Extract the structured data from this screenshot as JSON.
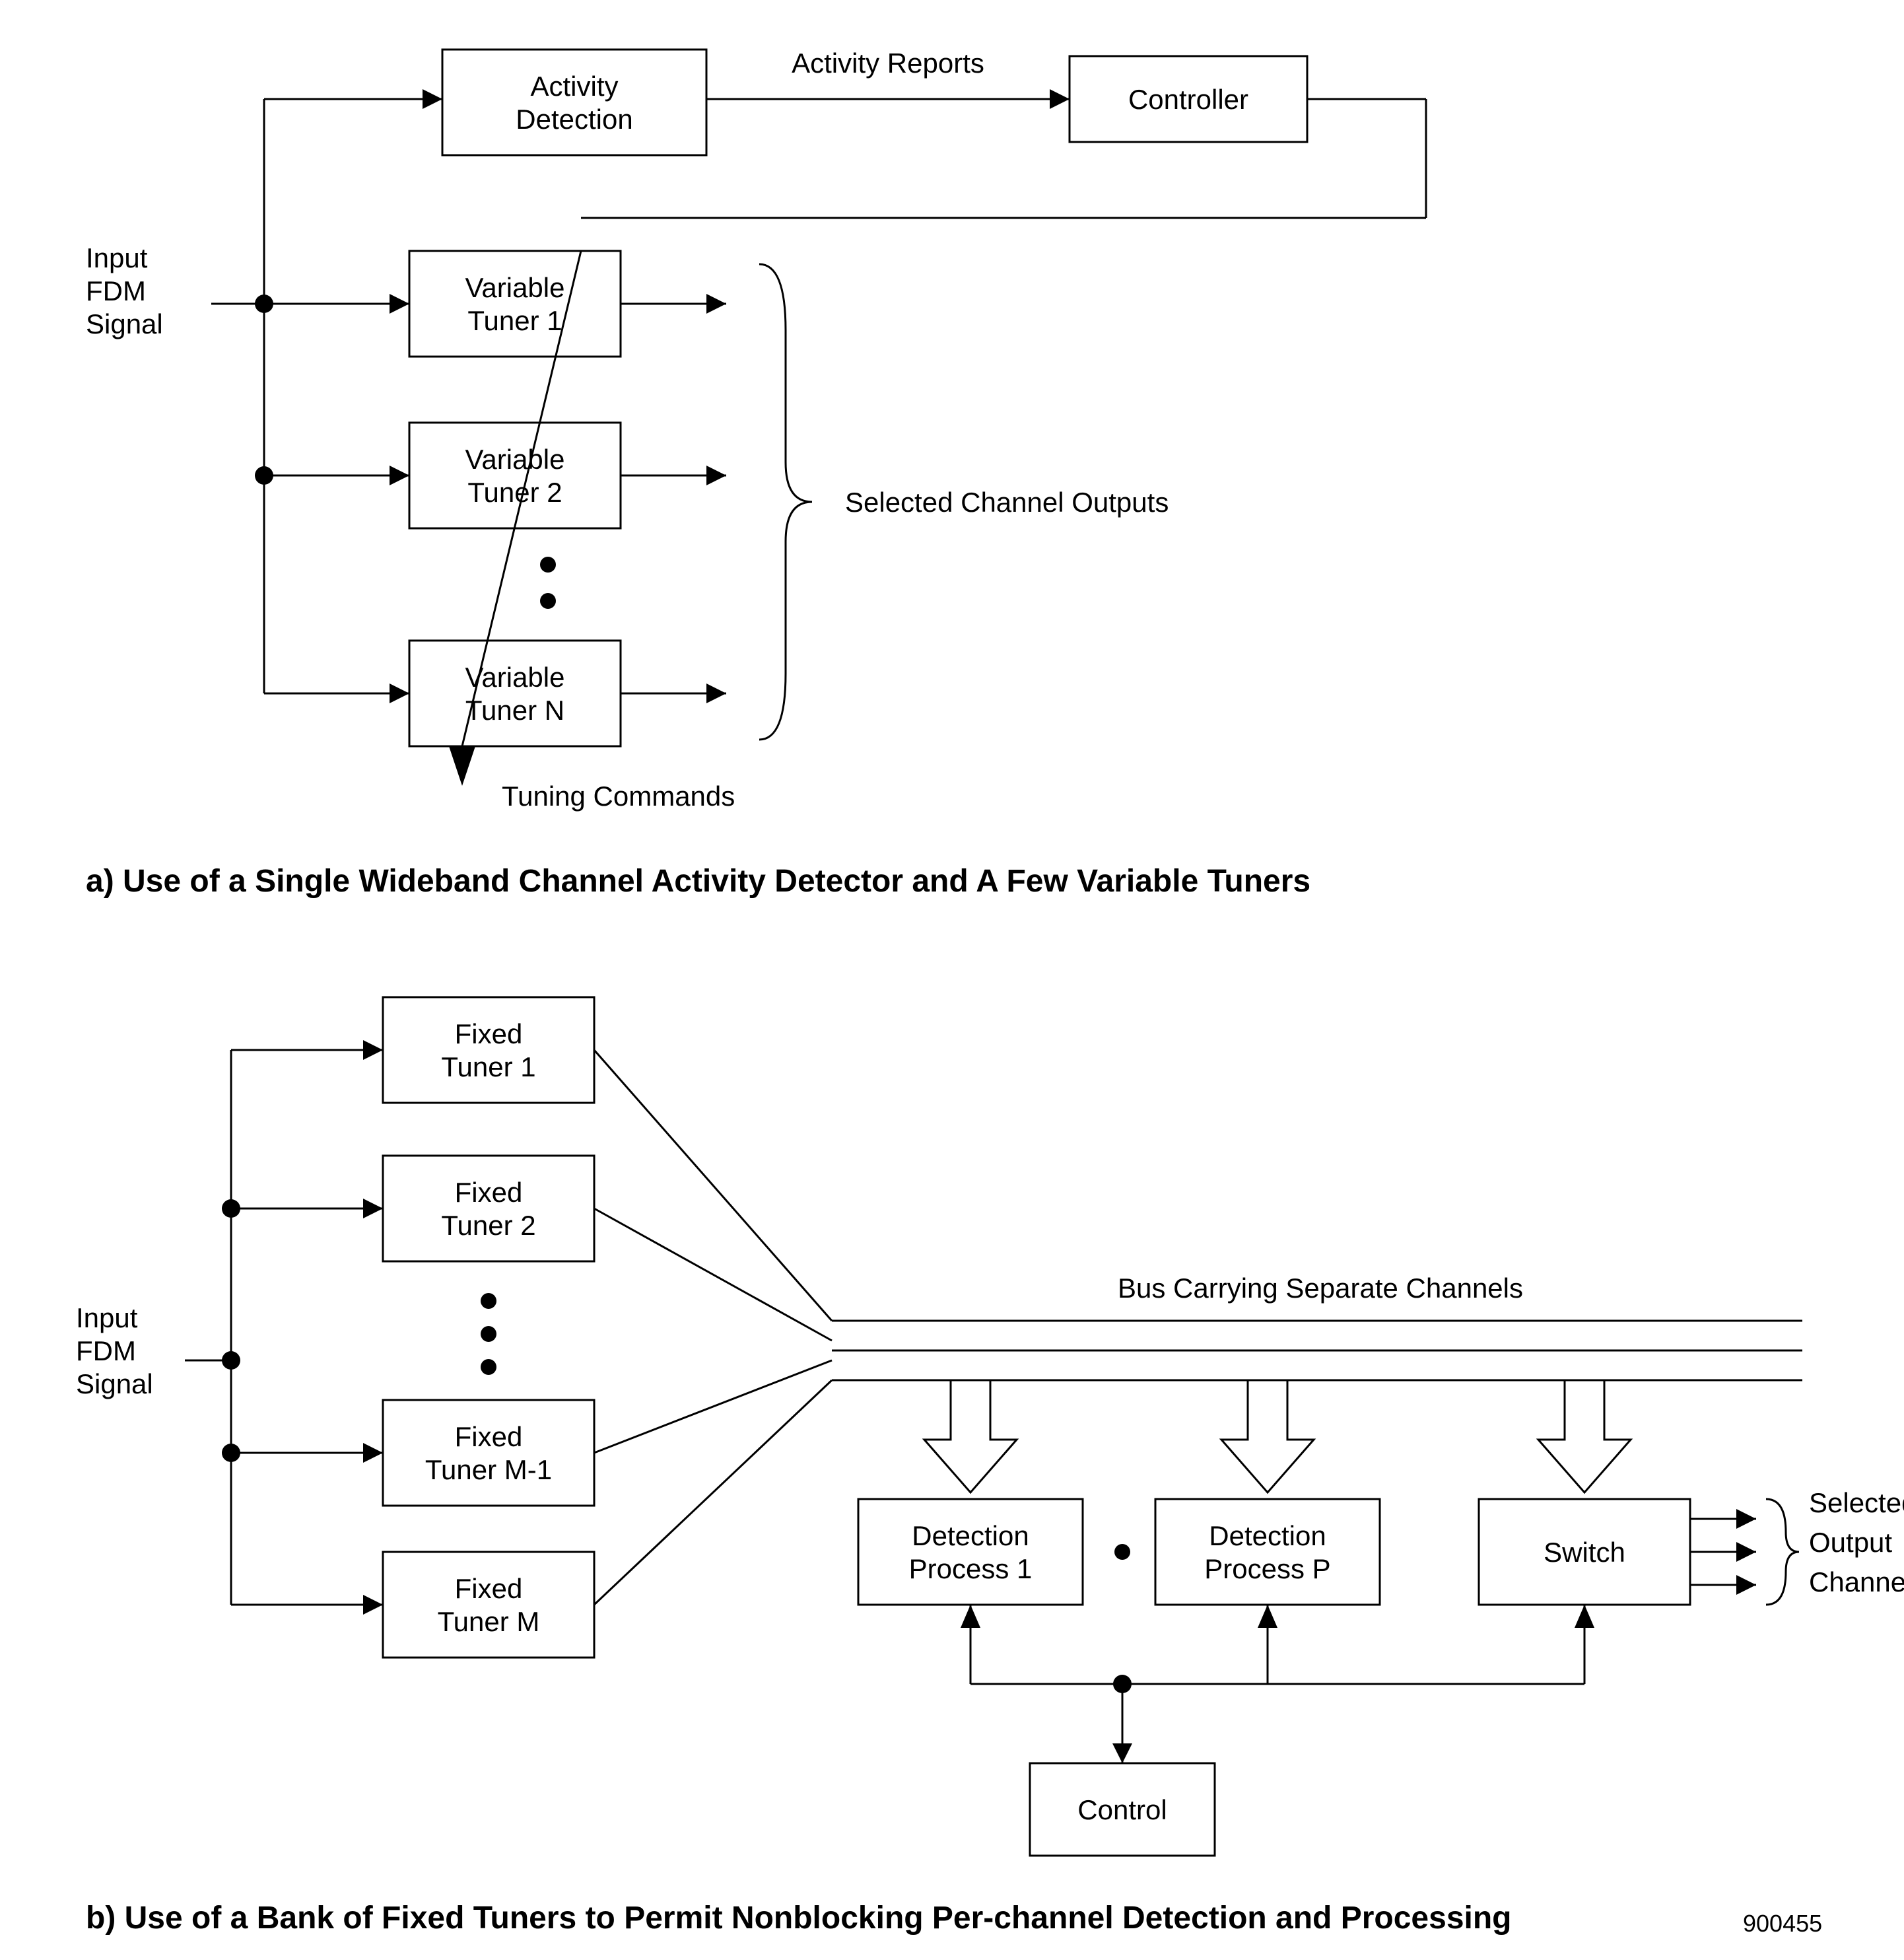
{
  "a": {
    "input_l1": "Input",
    "input_l2": "FDM",
    "input_l3": "Signal",
    "activity_l1": "Activity",
    "activity_l2": "Detection",
    "activity_reports": "Activity Reports",
    "controller": "Controller",
    "tuner1_l1": "Variable",
    "tuner1_l2": "Tuner 1",
    "tuner2_l1": "Variable",
    "tuner2_l2": "Tuner 2",
    "tunerN_l1": "Variable",
    "tunerN_l2": "Tuner N",
    "selected": "Selected Channel Outputs",
    "tuning": "Tuning Commands",
    "caption": "a) Use of a Single Wideband Channel Activity Detector and A Few Variable Tuners"
  },
  "b": {
    "input_l1": "Input",
    "input_l2": "FDM",
    "input_l3": "Signal",
    "ft1_l1": "Fixed",
    "ft1_l2": "Tuner 1",
    "ft2_l1": "Fixed",
    "ft2_l2": "Tuner 2",
    "ftM1_l1": "Fixed",
    "ftM1_l2": "Tuner M-1",
    "ftM_l1": "Fixed",
    "ftM_l2": "Tuner M",
    "bus": "Bus Carrying Separate Channels",
    "dp1_l1": "Detection",
    "dp1_l2": "Process 1",
    "dpP_l1": "Detection",
    "dpP_l2": "Process P",
    "switch": "Switch",
    "sel_l1": "Selected",
    "sel_l2": "Output",
    "sel_l3": "Channels",
    "control": "Control",
    "caption": "b) Use of a Bank of Fixed Tuners to Permit Nonblocking Per-channel Detection and Processing",
    "figid": "900455"
  }
}
